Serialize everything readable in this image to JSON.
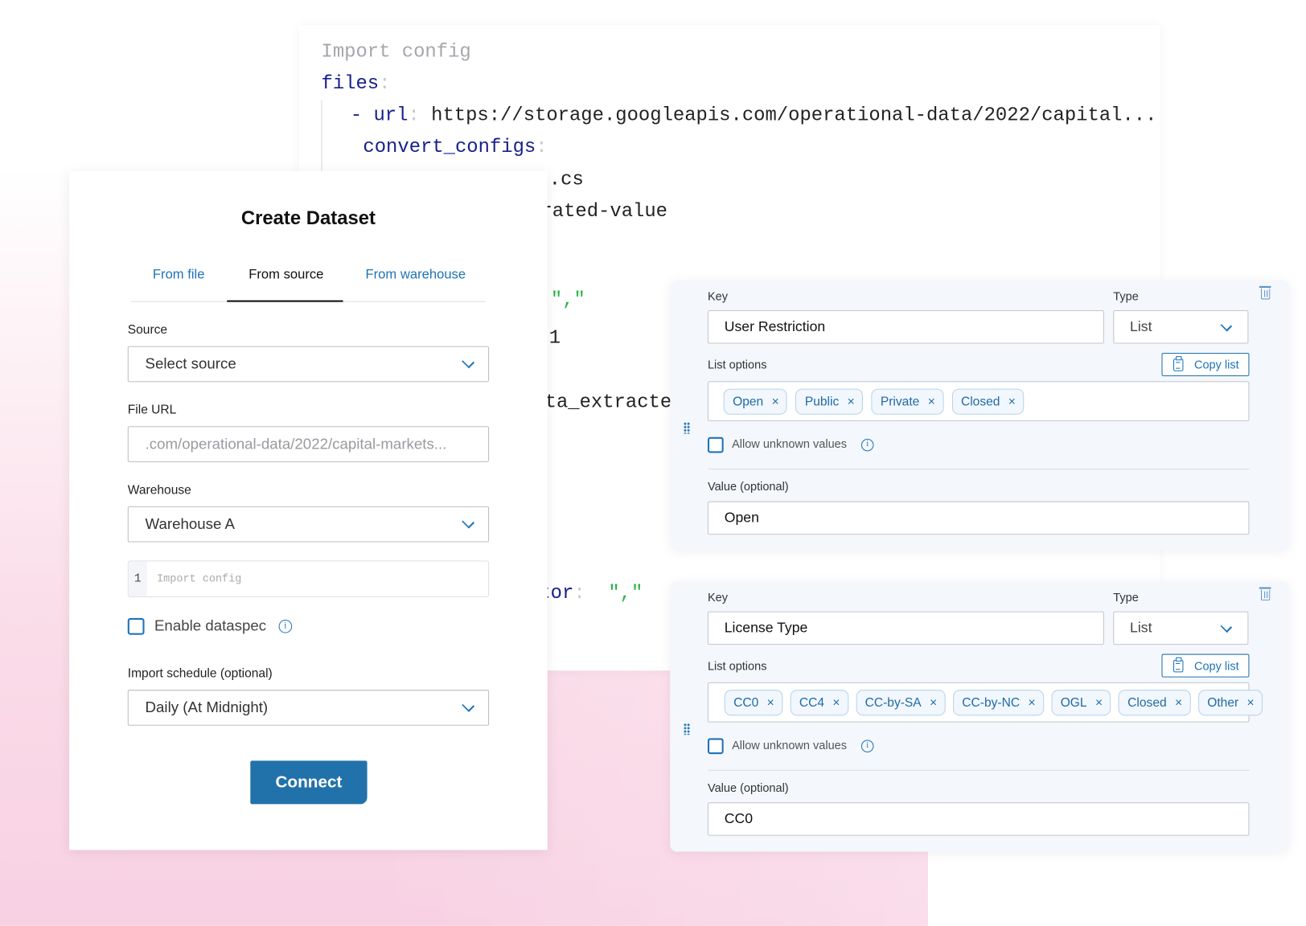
{
  "code_panel": {
    "lines": [
      {
        "text": "Import config"
      },
      {
        "key": "files"
      },
      {
        "dash": "- ",
        "key": "url",
        "value": "https://storage.googleapis.com/operational-data/2022/capital...;"
      },
      {
        "key": "convert_configs"
      },
      {
        "text": ".cs"
      },
      {
        "text": "rated-value"
      },
      {
        "string": "\",\""
      },
      {
        "text": "1"
      },
      {
        "text": "ta_extracte"
      },
      {
        "key": "tor",
        "string": "\",\""
      }
    ]
  },
  "create_dataset": {
    "title": "Create Dataset",
    "tabs": [
      {
        "label": "From file",
        "active": false
      },
      {
        "label": "From source",
        "active": true
      },
      {
        "label": "From warehouse",
        "active": false
      }
    ],
    "source": {
      "label": "Source",
      "placeholder": "Select source"
    },
    "file_url": {
      "label": "File URL",
      "value": ".com/operational-data/2022/capital-markets..."
    },
    "warehouse": {
      "label": "Warehouse",
      "value": "Warehouse A"
    },
    "config_editor": {
      "line_number": "1",
      "placeholder": "Import config"
    },
    "enable_dataspec": {
      "label": "Enable dataspec",
      "checked": false
    },
    "import_schedule": {
      "label": "Import schedule (optional)",
      "value": "Daily (At Midnight)"
    },
    "connect_label": "Connect"
  },
  "metadata_cards": [
    {
      "key_label": "Key",
      "key_value": "User Restriction",
      "type_label": "Type",
      "type_value": "List",
      "list_options_label": "List options",
      "copy_list_label": "Copy list",
      "tags": [
        "Open",
        "Public",
        "Private",
        "Closed"
      ],
      "allow_unknown_label": "Allow unknown values",
      "allow_unknown_checked": false,
      "value_label": "Value (optional)",
      "value": "Open"
    },
    {
      "key_label": "Key",
      "key_value": "License Type",
      "type_label": "Type",
      "type_value": "List",
      "list_options_label": "List options",
      "copy_list_label": "Copy list",
      "tags": [
        "CC0",
        "CC4",
        "CC-by-SA",
        "CC-by-NC",
        "OGL",
        "Closed",
        "Other"
      ],
      "allow_unknown_label": "Allow unknown values",
      "allow_unknown_checked": false,
      "value_label": "Value (optional)",
      "value": "CC0"
    }
  ],
  "colors": {
    "accent": "#2172ab",
    "code_key": "#17208c",
    "code_string": "#2bb24c",
    "background_pink": "#f8d1e3"
  },
  "icons": {
    "x": "×",
    "info": "i"
  }
}
